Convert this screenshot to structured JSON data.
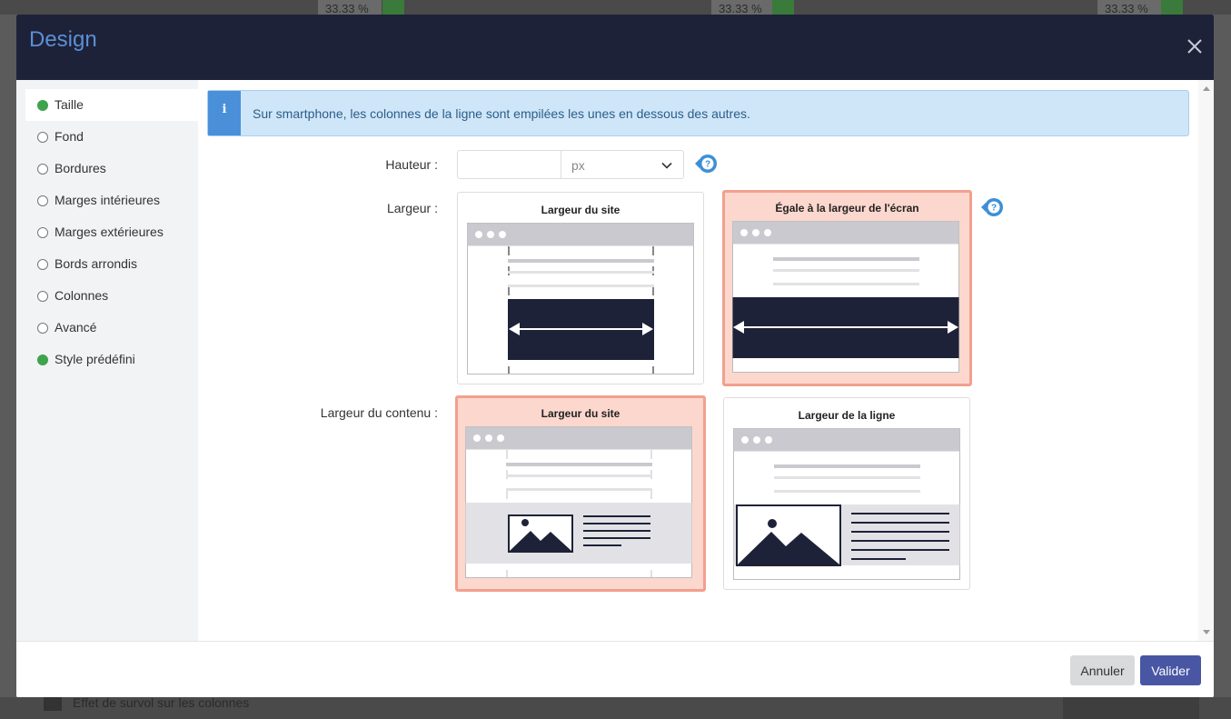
{
  "background": {
    "percent_values": [
      "33.33 %",
      "33.33 %",
      "33.33 %"
    ],
    "bottom_text": "Effet de survol sur les colonnes"
  },
  "dialog": {
    "title": "Design",
    "close_icon": "close-icon"
  },
  "sidebar": {
    "items": [
      {
        "label": "Taille",
        "filled": true,
        "active": true
      },
      {
        "label": "Fond",
        "filled": false,
        "active": false
      },
      {
        "label": "Bordures",
        "filled": false,
        "active": false
      },
      {
        "label": "Marges intérieures",
        "filled": false,
        "active": false
      },
      {
        "label": "Marges extérieures",
        "filled": false,
        "active": false
      },
      {
        "label": "Bords arrondis",
        "filled": false,
        "active": false
      },
      {
        "label": "Colonnes",
        "filled": false,
        "active": false
      },
      {
        "label": "Avancé",
        "filled": false,
        "active": false
      },
      {
        "label": "Style prédéfini",
        "filled": true,
        "active": false
      }
    ]
  },
  "info": {
    "icon": "i",
    "text": "Sur smartphone, les colonnes de la ligne sont empilées les unes en dessous des autres."
  },
  "form": {
    "hauteur_label": "Hauteur :",
    "hauteur_value": "",
    "hauteur_unit": "px",
    "largeur_label": "Largeur :",
    "largeur_options": [
      {
        "title": "Largeur du site",
        "selected": false
      },
      {
        "title": "Égale à la largeur de l'écran",
        "selected": true
      }
    ],
    "contenu_label": "Largeur du contenu :",
    "contenu_options": [
      {
        "title": "Largeur du site",
        "selected": true
      },
      {
        "title": "Largeur de la ligne",
        "selected": false
      }
    ]
  },
  "footer": {
    "cancel_label": "Annuler",
    "ok_label": "Valider"
  },
  "colors": {
    "header_bg": "#1e2238",
    "title": "#5b8fd6",
    "selected_card_bg": "#fcd7cd",
    "selected_card_border": "#f2a08e",
    "primary_button": "#4856a4",
    "active_dot": "#3fa34d",
    "info_bg": "#cfe6f8"
  }
}
